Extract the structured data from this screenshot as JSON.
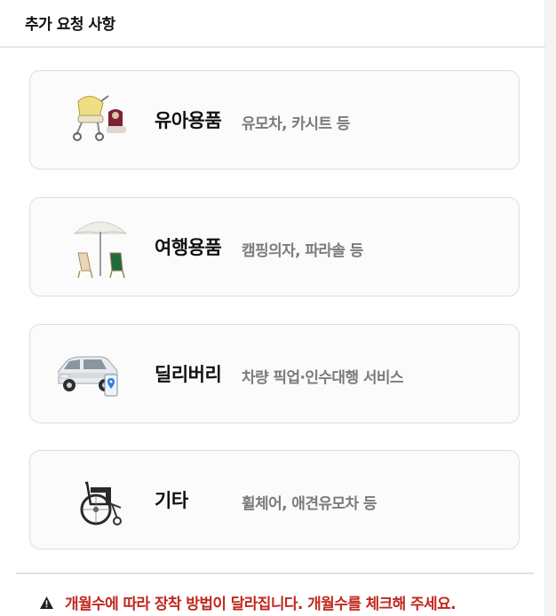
{
  "header": {
    "title": "추가 요청 사항"
  },
  "cards": [
    {
      "title": "유아용품",
      "desc": "유모차, 카시트 등",
      "icon": "stroller-icon"
    },
    {
      "title": "여행용품",
      "desc": "캠핑의자, 파라솔 등",
      "icon": "parasol-chairs-icon"
    },
    {
      "title": "딜리버리",
      "desc": "차량 픽업·인수대행 서비스",
      "icon": "car-delivery-icon"
    },
    {
      "title": "기타",
      "desc": "휠체어, 애견유모차 등",
      "icon": "wheelchair-icon"
    }
  ],
  "notice": {
    "text": "개월수에 따라 장착 방법이 달라집니다. 개월수를 체크해 주세요.",
    "icon": "warning-icon"
  },
  "colors": {
    "warning": "#c0281f",
    "card_border": "#dedede",
    "card_bg": "#fbfbfb"
  }
}
